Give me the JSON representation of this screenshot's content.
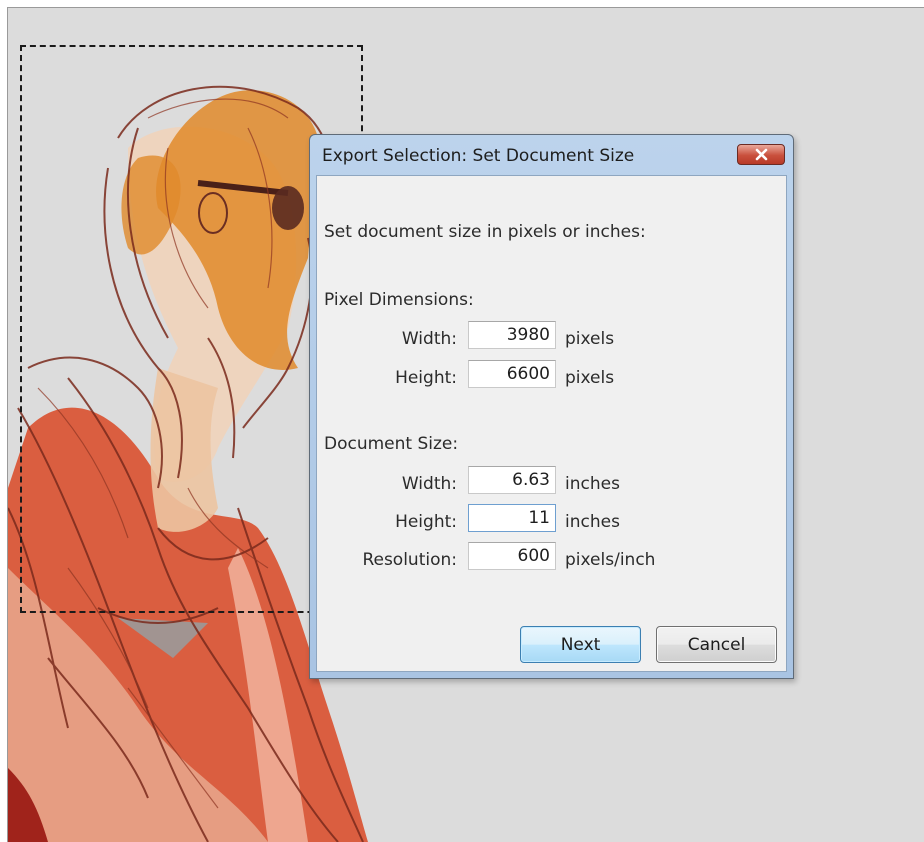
{
  "dialog": {
    "title": "Export Selection: Set Document Size",
    "instruction": "Set document size in pixels or inches:",
    "pixel_dimensions": {
      "heading": "Pixel Dimensions:",
      "width_label": "Width:",
      "width_value": "3980",
      "width_unit": "pixels",
      "height_label": "Height:",
      "height_value": "6600",
      "height_unit": "pixels"
    },
    "document_size": {
      "heading": "Document Size:",
      "width_label": "Width:",
      "width_value": "6.63",
      "width_unit": "inches",
      "height_label": "Height:",
      "height_value": "11",
      "height_unit": "inches",
      "resolution_label": "Resolution:",
      "resolution_value": "600",
      "resolution_unit": "pixels/inch"
    },
    "buttons": {
      "next_label": "Next",
      "cancel_label": "Cancel"
    }
  },
  "icons": {
    "close": "close-icon"
  },
  "colors": {
    "titlebar": "#b3cce8",
    "close_button": "#c9503d",
    "canvas_background": "#dcdcdc",
    "next_button_border": "#3c7fb1"
  }
}
